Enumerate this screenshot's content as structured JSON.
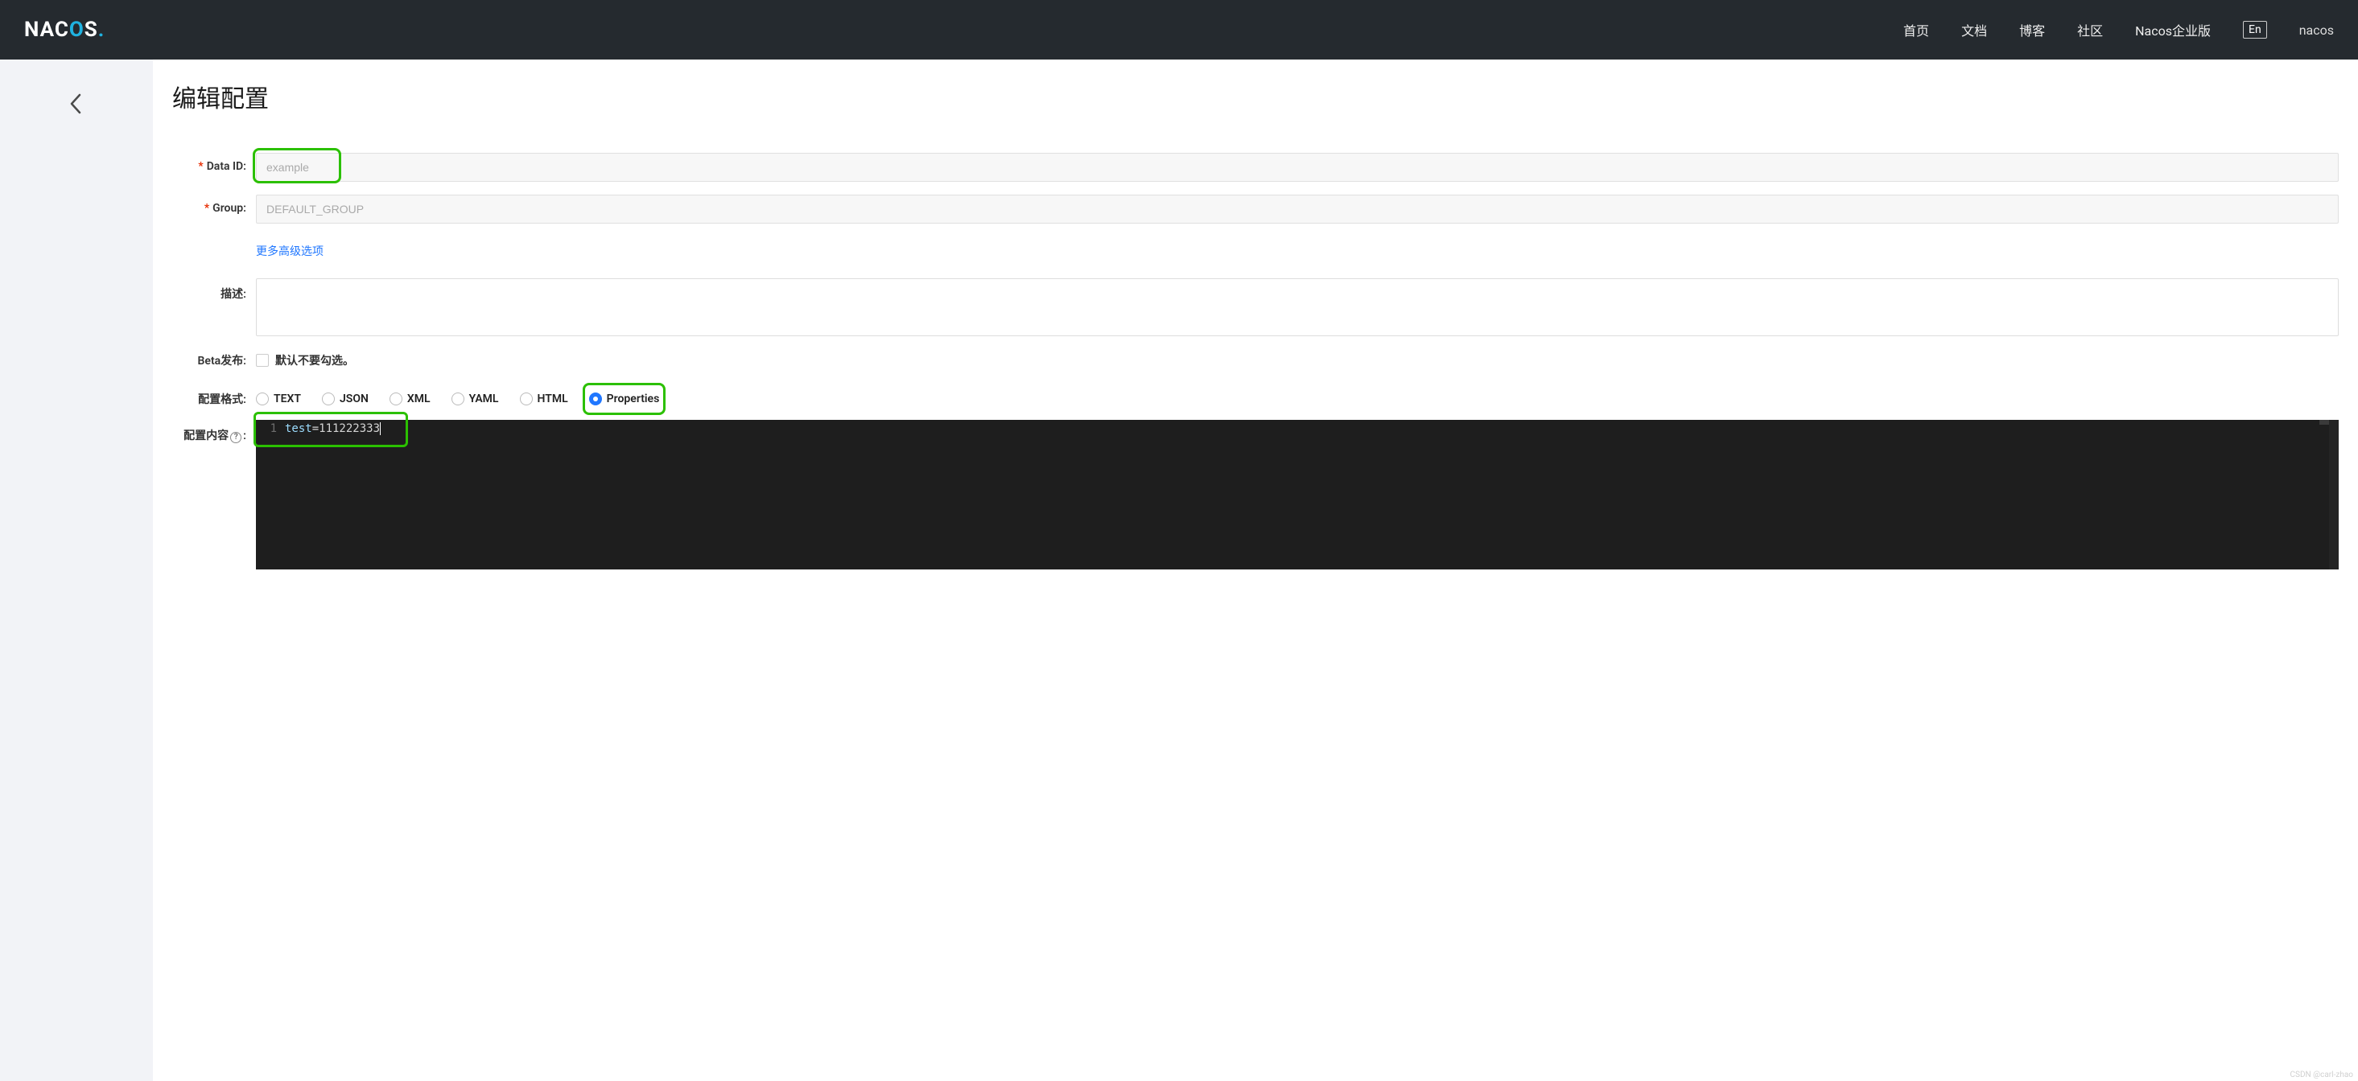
{
  "header": {
    "logo_text_pre": "NAC",
    "logo_text_mid": "O",
    "logo_text_post": "S",
    "logo_dot": ".",
    "nav": [
      "首页",
      "文档",
      "博客",
      "社区",
      "Nacos企业版"
    ],
    "lang": "En",
    "user": "nacos"
  },
  "page": {
    "title": "编辑配置"
  },
  "form": {
    "data_id": {
      "label": "Data ID:",
      "value": "example"
    },
    "group": {
      "label": "Group:",
      "value": "DEFAULT_GROUP"
    },
    "more_options": "更多高级选项",
    "description": {
      "label": "描述:",
      "value": ""
    },
    "beta": {
      "label": "Beta发布:",
      "checkbox_label": "默认不要勾选。",
      "checked": false
    },
    "format": {
      "label": "配置格式:",
      "options": [
        "TEXT",
        "JSON",
        "XML",
        "YAML",
        "HTML",
        "Properties"
      ],
      "selected": "Properties"
    },
    "content": {
      "label_pre": "配置内容",
      "label_post": ":",
      "help_char": "?",
      "line_number": "1",
      "code_key": "test",
      "code_rest": "=111222333"
    }
  },
  "watermark": "CSDN @carl-zhao"
}
